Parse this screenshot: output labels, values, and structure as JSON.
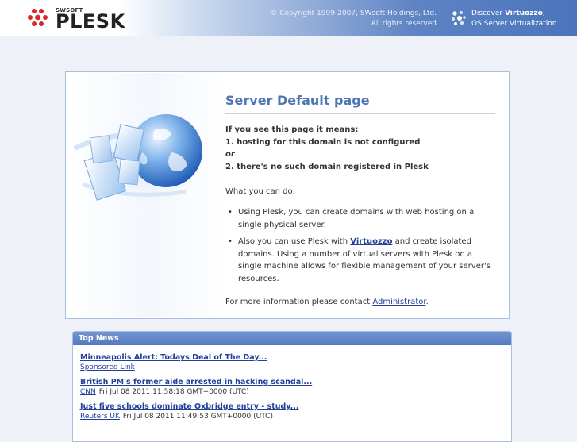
{
  "header": {
    "logo_vendor": "SWSOFT",
    "logo_product": "PLESK",
    "copyright_line1": "© Copyright 1999-2007, SWsoft Holdings, Ltd.",
    "copyright_line2": "All rights reserved",
    "discover_prefix": "Discover ",
    "discover_brand": "Virtuozzo",
    "discover_suffix": ",",
    "discover_line2": "OS Server Virtualization"
  },
  "main": {
    "title": "Server Default page",
    "means_heading": "If you see this page it means:",
    "reason_1": "1. hosting for this domain is not configured",
    "or_text": "or",
    "reason_2": "2. there's no such domain registered in Plesk",
    "what_heading": "What you can do:",
    "bullet": "•",
    "tip1": "Using Plesk, you can create domains with web hosting on a single physical server.",
    "tip2_before": "Also you can use Plesk with ",
    "tip2_link": "Virtuozzo",
    "tip2_after": " and create isolated domains. Using a number of virtual servers with Plesk on a single machine allows for flexible management of your server's resources.",
    "contact_before": "For more information please contact ",
    "contact_link": "Administrator",
    "contact_after": "."
  },
  "news": {
    "heading": "Top News",
    "items": [
      {
        "title": "Minneapolis Alert: Todays Deal of The Day...",
        "source": "Sponsored Link",
        "date": ""
      },
      {
        "title": "British PM's former aide arrested in hacking scandal...",
        "source": "CNN",
        "date": "Fri Jul 08 2011 11:58:18 GMT+0000 (UTC)"
      },
      {
        "title": "Just five schools dominate Oxbridge entry - study...",
        "source": "Reuters UK",
        "date": "Fri Jul 08 2011 11:49:53 GMT+0000 (UTC)"
      }
    ]
  },
  "colors": {
    "title_blue": "#4d76b3",
    "link_blue": "#22409a",
    "header_blue": "#4a74bd",
    "logo_red": "#d9262b"
  },
  "icons": {
    "logo": "plesk-dots-logo-icon",
    "virtuozzo": "virtuozzo-cluster-icon",
    "illustration": "globe-documents-illustration"
  }
}
